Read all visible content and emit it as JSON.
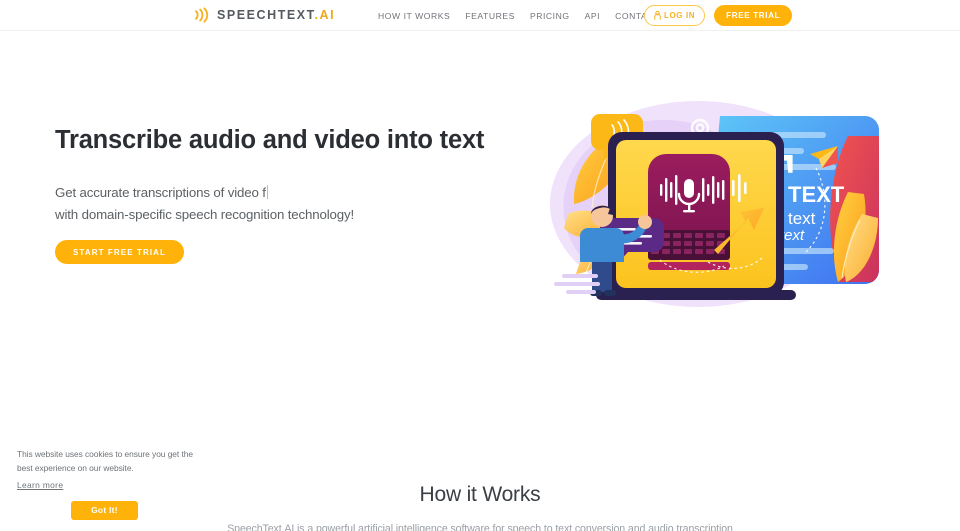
{
  "header": {
    "logo": {
      "mark_icon": "soundwave-icon",
      "name": "SPEECHTEXT",
      "suffix": ".AI"
    },
    "nav": [
      {
        "label": "HOW IT WORKS",
        "name": "nav-how-it-works"
      },
      {
        "label": "FEATURES",
        "name": "nav-features"
      },
      {
        "label": "PRICING",
        "name": "nav-pricing"
      },
      {
        "label": "API",
        "name": "nav-api"
      },
      {
        "label": "CONTACT US",
        "name": "nav-contact-us"
      }
    ],
    "login_label": "LOG IN",
    "login_icon": "user-lock-icon",
    "free_trial_label": "FREE TRIAL"
  },
  "hero": {
    "title": "Transcribe audio and video into text",
    "subtitle_line1": "Get accurate transcriptions of video f",
    "subtitle_line2": "with domain-specific speech recognition technology!",
    "cta_label": "START FREE TRIAL",
    "illustration": {
      "name": "speech-to-text-illustration",
      "text_big": "T",
      "text_caps": "TEXT",
      "text_bold": "text",
      "text_regular": "text",
      "text_italic": "text",
      "microphone_icon": "microphone-icon",
      "gear_icon": "gear-icon",
      "paper_plane_icon": "paper-plane-icon",
      "speech_bubble_icon": "speech-bubble-icon"
    }
  },
  "how_it_works": {
    "title": "How it Works",
    "paragraph": "SpeechText.AI is a powerful artificial intelligence software for speech to text conversion and audio transcription"
  },
  "cookie_banner": {
    "message": "This website uses cookies to ensure you get the best experience on our website.",
    "learn_more_label": "Learn more",
    "accept_label": "Got It!"
  },
  "colors": {
    "brand_orange": "#ffb30a",
    "brand_amber": "#f2a71b",
    "text_dark": "#2b2f34",
    "text_muted": "#6f7479",
    "background": "#ffffff"
  }
}
